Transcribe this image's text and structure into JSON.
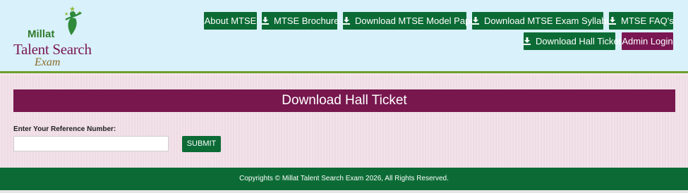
{
  "logo": {
    "line1": "Millat",
    "line2": "Talent Search",
    "line3": "Exam"
  },
  "nav": {
    "about": "About MTSE",
    "brochure": "MTSE Brochure",
    "model_paper": "Download MTSE Model Paper",
    "syllabus": "Download MTSE Exam Syllabus",
    "faq": "MTSE FAQ's",
    "hall_ticket": "Download Hall Ticket",
    "admin_login": "Admin Login"
  },
  "icons": {
    "download": "download-icon"
  },
  "main": {
    "title": "Download Hall Ticket",
    "ref_label": "Enter Your Reference Number:",
    "ref_value": "",
    "submit_label": "SUBMIT"
  },
  "footer": {
    "text": "Copyrights © Millat Talent Search Exam 2026, All Rights Reserved."
  },
  "colors": {
    "primary_green": "#0c6b35",
    "maroon": "#77174e",
    "header_bg": "#d9f1fb",
    "header_border": "#6e9f2c"
  }
}
